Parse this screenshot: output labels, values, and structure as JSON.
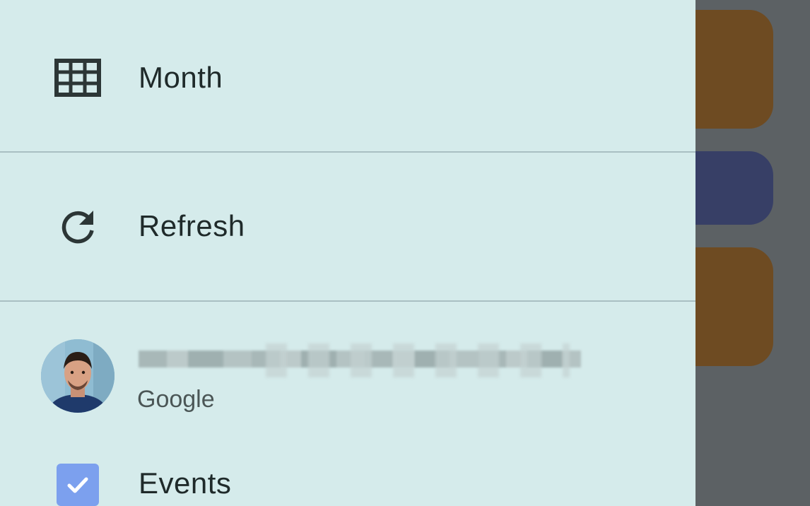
{
  "drawer": {
    "menu": [
      {
        "label": "Month",
        "icon": "month-grid-icon"
      },
      {
        "label": "Refresh",
        "icon": "refresh-icon"
      }
    ],
    "account": {
      "email": "",
      "provider": "Google"
    },
    "calendars": [
      {
        "label": "Events",
        "checked": true,
        "color": "#7ca0ee"
      }
    ]
  },
  "colors": {
    "drawer_background": "#d5ebeb",
    "scrim": "#5c6164",
    "event_orange": "#6e4b22",
    "event_blue": "#373f66"
  }
}
